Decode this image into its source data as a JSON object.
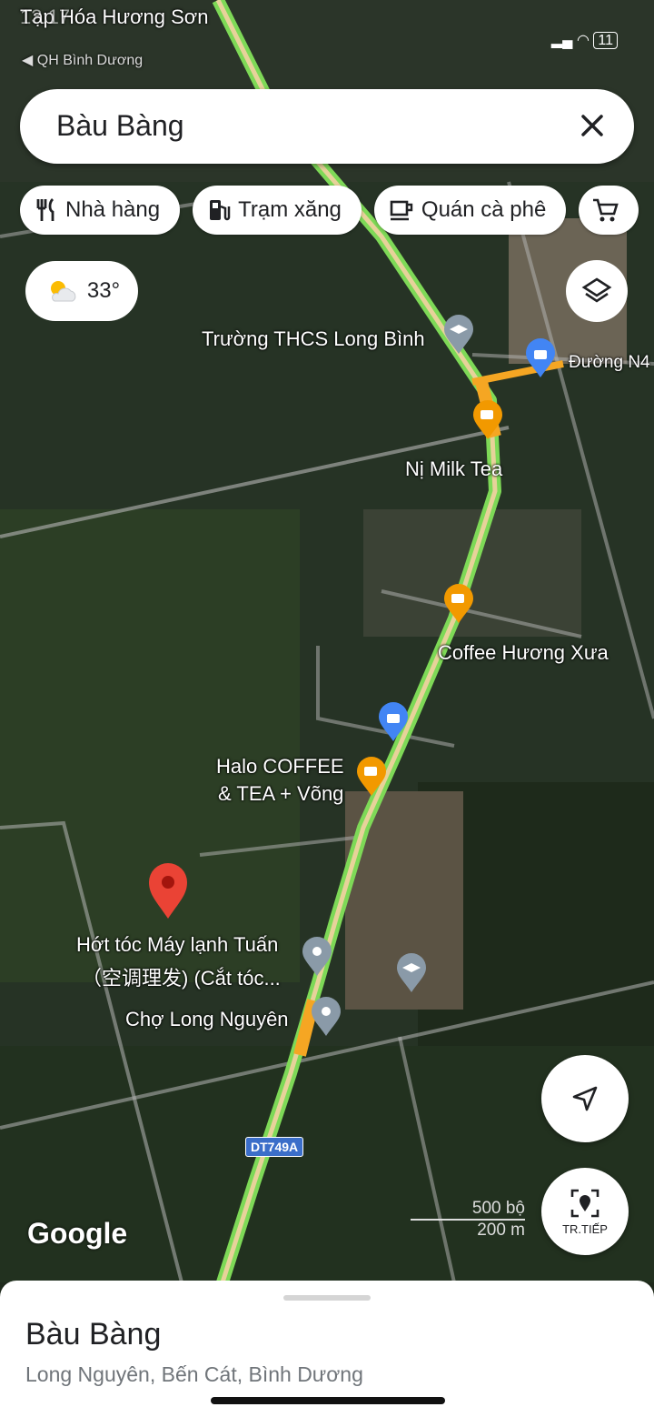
{
  "status": {
    "time": "13:17",
    "back_label": "◀ QH Bình Dương",
    "battery": "11"
  },
  "search": {
    "query": "Bàu Bàng"
  },
  "chips": [
    "Nhà hàng",
    "Trạm xăng",
    "Quán cà phê"
  ],
  "weather": {
    "temp": "33°"
  },
  "map_labels": {
    "top": "Tạp Hóa Hương Sơn",
    "school": "Trường THCS Long Bình",
    "road": "Đường N4",
    "milk_tea": "Nị Milk Tea",
    "coffee1": "Coffee Hương Xưa",
    "coffee2_line1": "Halo COFFEE",
    "coffee2_line2": "& TEA + Võng",
    "barber_line1": "Hớt tóc Máy lạnh Tuấn",
    "barber_line2": "（空调理发) (Cắt tóc...",
    "market": "Chợ Long Nguyên",
    "shield": "DT749A"
  },
  "brand": "Google",
  "scale": {
    "imperial": "500 bộ",
    "metric": "200 m"
  },
  "navigate": {
    "label": "TR.TIẾP"
  },
  "sheet": {
    "title": "Bàu Bàng",
    "address": "Long Nguyên, Bến Cát, Bình Dương"
  },
  "colors": {
    "road_green": "#7ed957",
    "road_orange": "#f5a623",
    "pin_red": "#ea4335",
    "cafe_orange": "#f29900",
    "shop_blue": "#4285f4",
    "grey_pin": "#8a9aa8"
  }
}
